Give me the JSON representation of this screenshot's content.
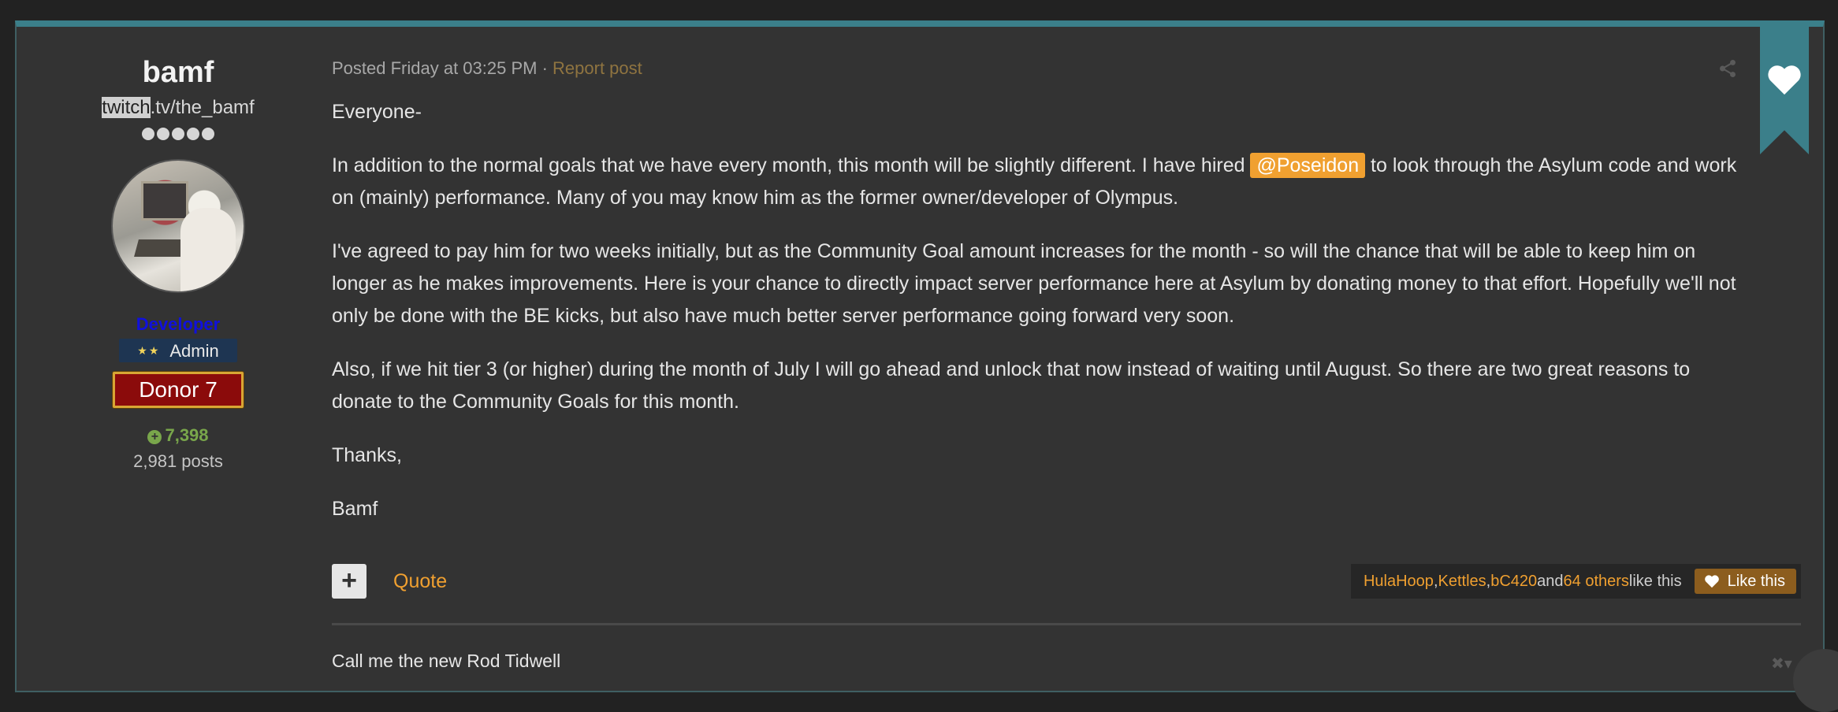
{
  "author": {
    "name": "bamf",
    "link_highlight": "twitch",
    "link_rest": ".tv/the_bamf",
    "group_title": "Developer",
    "badge_admin": "Admin",
    "badge_donor": "Donor 7",
    "reputation": "7,398",
    "post_count": "2,981 posts"
  },
  "post": {
    "posted": "Posted Friday at 03:25 PM",
    "separator": " · ",
    "report": "Report post",
    "p1": "Everyone-",
    "p2a": "In addition to the normal goals that we have every month, this month will be slightly different.  I have hired ",
    "mention": "@Poseidon",
    "p2b": " to look through the Asylum code and work on (mainly) performance.  Many of you may know him as the former owner/developer of Olympus.",
    "p3": "I've agreed to pay him for two weeks initially, but as the Community Goal amount increases for the month - so will the chance that will be able to keep him on longer as he makes improvements.  Here is your chance to directly impact server performance here at Asylum by donating money to that effort.  Hopefully we'll not only be done with the BE kicks, but also have much better server performance going forward very soon.",
    "p4": "Also, if we hit tier 3 (or higher) during the month of July I will go ahead and unlock that now instead of waiting until August.  So there are two great reasons to donate to the Community Goals for this month.",
    "p5": "Thanks,",
    "p6": "Bamf"
  },
  "actions": {
    "plus": "+",
    "quote": "Quote",
    "likers": [
      "HulaHoop",
      "Kettles",
      "bC420"
    ],
    "comma": ", ",
    "and": " and ",
    "others": "64 others",
    "like_this": " like this",
    "like_button": "Like this"
  },
  "signature": {
    "text": "Call me the new Rod Tidwell",
    "control": "✖▾"
  },
  "icons": {
    "share": "share-icon",
    "heart": "heart-icon",
    "reputation": "plus-circle-icon"
  },
  "colors": {
    "accent": "#f0a030",
    "teal": "#3b7f8a",
    "group": "#1010dd",
    "reputation": "#79a64b"
  }
}
